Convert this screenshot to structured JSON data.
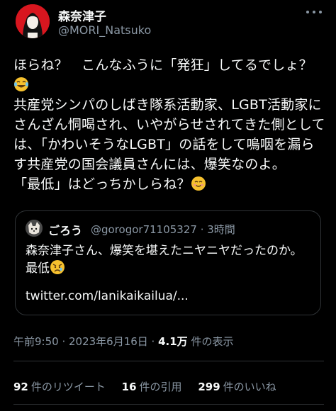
{
  "author": {
    "name": "森奈津子",
    "handle": "@MORI_Natsuko"
  },
  "tweet": {
    "line1": "ほらね？　こんなふうに「発狂」してるでしょ？",
    "body": "共産党シンパのしばき隊系活動家、LGBT活動家にさんざん恫喝され、いやがらせされてきた側としては、「かわいそうなLGBT」の話をして嗚咽を漏らす共産党の国会議員さんには、爆笑なのよ。",
    "line_last": "「最低」はどっちかしらね？"
  },
  "quote": {
    "name": "ごろう",
    "handle_time": "@gorogor71105327 · 3時間",
    "text": "森奈津子さん、爆笑を堪えたニヤニヤだったのか。最低",
    "link": "twitter.com/lanikaikailua/..."
  },
  "meta": {
    "timestamp": "午前9:50 · 2023年6月16日 · ",
    "views_count": "4.1万",
    "views_label": " 件の表示"
  },
  "stats": {
    "retweets_count": "92",
    "retweets_label": "件のリツイート",
    "quotes_count": "16",
    "quotes_label": "件の引用",
    "likes_count": "299",
    "likes_label": "件のいいね"
  },
  "colors": {
    "background": "#000000",
    "text": "#e7e9ea",
    "secondary": "#8b98a5",
    "border": "#2f3336",
    "avatar_bg": "#d8161f"
  },
  "icons": [
    "more-icon",
    "laughing-emoji",
    "smiling-emoji",
    "sad-emoji"
  ]
}
